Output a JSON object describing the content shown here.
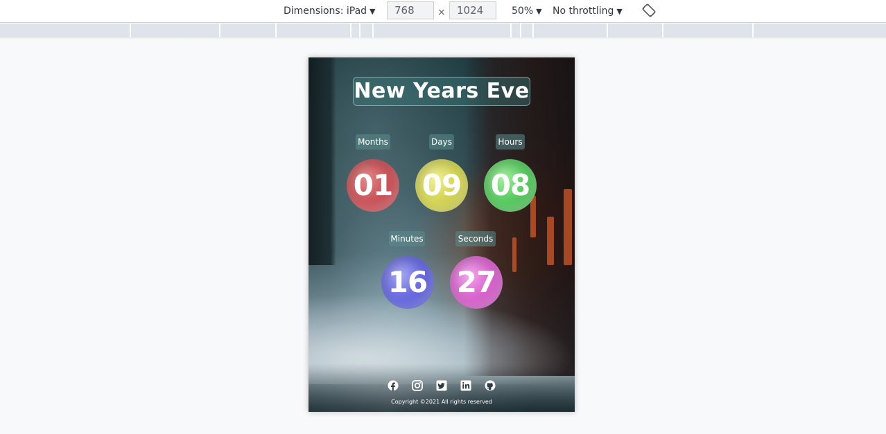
{
  "devtools": {
    "dimensions_label": "Dimensions: iPad",
    "width_value": "768",
    "times_sign": "×",
    "height_value": "1024",
    "zoom_label": "50%",
    "throttling_label": "No throttling",
    "rotate_icon": "rotate-icon"
  },
  "page": {
    "title": "New Years Eve",
    "countdown": [
      {
        "label": "Months",
        "value": "01",
        "color": "#c64a50"
      },
      {
        "label": "Days",
        "value": "09",
        "color": "#cfd04a"
      },
      {
        "label": "Hours",
        "value": "08",
        "color": "#4bc454"
      },
      {
        "label": "Minutes",
        "value": "16",
        "color": "#5c5fdc"
      },
      {
        "label": "Seconds",
        "value": "27",
        "color": "#d458c8"
      }
    ],
    "social_icons": [
      "facebook-icon",
      "instagram-icon",
      "twitter-icon",
      "linkedin-icon",
      "github-icon"
    ],
    "copyright": "Copyright ©2021 All rights reserved"
  }
}
